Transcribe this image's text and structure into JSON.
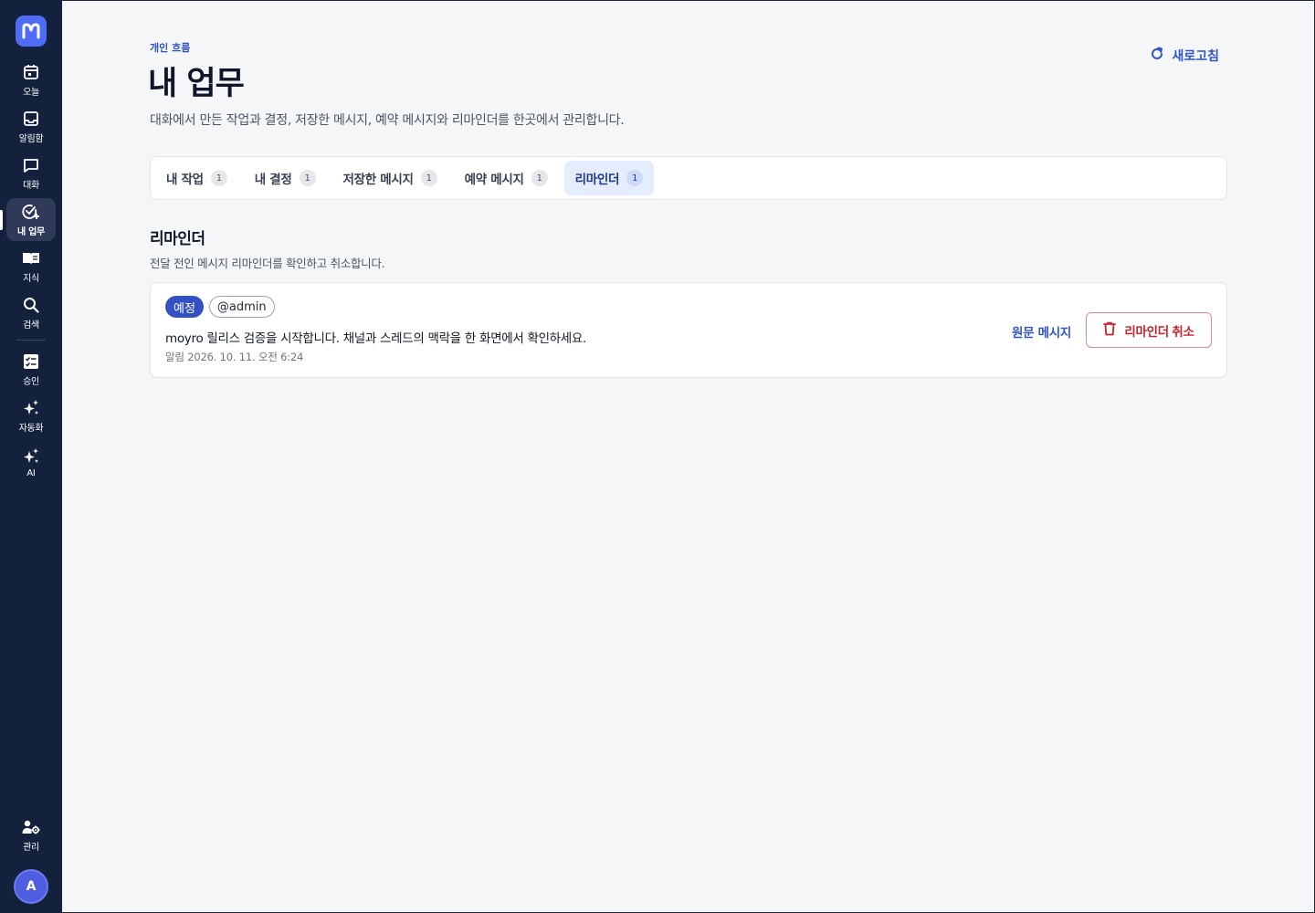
{
  "sidebar": {
    "logo_icon": "moyro-logo-icon",
    "items": [
      {
        "label": "오늘",
        "icon": "calendar-icon"
      },
      {
        "label": "알림함",
        "icon": "inbox-icon"
      },
      {
        "label": "대화",
        "icon": "chat-icon"
      },
      {
        "label": "내 업무",
        "icon": "task-check-icon",
        "active": true
      },
      {
        "label": "지식",
        "icon": "book-icon"
      },
      {
        "label": "검색",
        "icon": "search-icon"
      },
      {
        "label": "승인",
        "icon": "approval-icon"
      },
      {
        "label": "자동화",
        "icon": "sparkle-icon"
      },
      {
        "label": "AI",
        "icon": "ai-sparkle-icon"
      }
    ],
    "admin": {
      "label": "관리",
      "icon": "admin-gear-icon"
    },
    "avatar_initial": "A"
  },
  "header": {
    "eyebrow": "개인 흐름",
    "title": "내 업무",
    "description": "대화에서 만든 작업과 결정, 저장한 메시지, 예약 메시지와 리마인더를 한곳에서 관리합니다.",
    "refresh_label": "새로고침"
  },
  "tabs": [
    {
      "label": "내 작업",
      "count": "1"
    },
    {
      "label": "내 결정",
      "count": "1"
    },
    {
      "label": "저장한 메시지",
      "count": "1"
    },
    {
      "label": "예약 메시지",
      "count": "1"
    },
    {
      "label": "리마인더",
      "count": "1",
      "active": true
    }
  ],
  "section": {
    "title": "리마인더",
    "description": "전달 전인 메시지 리마인더를 확인하고 취소합니다."
  },
  "reminder": {
    "status": "예정",
    "user": "@admin",
    "message": "moyro 릴리스 검증을 시작합니다. 채널과 스레드의 맥락을 한 화면에서 확인하세요.",
    "meta": "알림 2026. 10. 11. 오전 6:24",
    "source_link": "원문 메시지",
    "cancel_label": "리마인더 취소"
  },
  "colors": {
    "sidebar_bg": "#14213d",
    "accent": "#2f54c8",
    "danger": "#c8232f"
  }
}
